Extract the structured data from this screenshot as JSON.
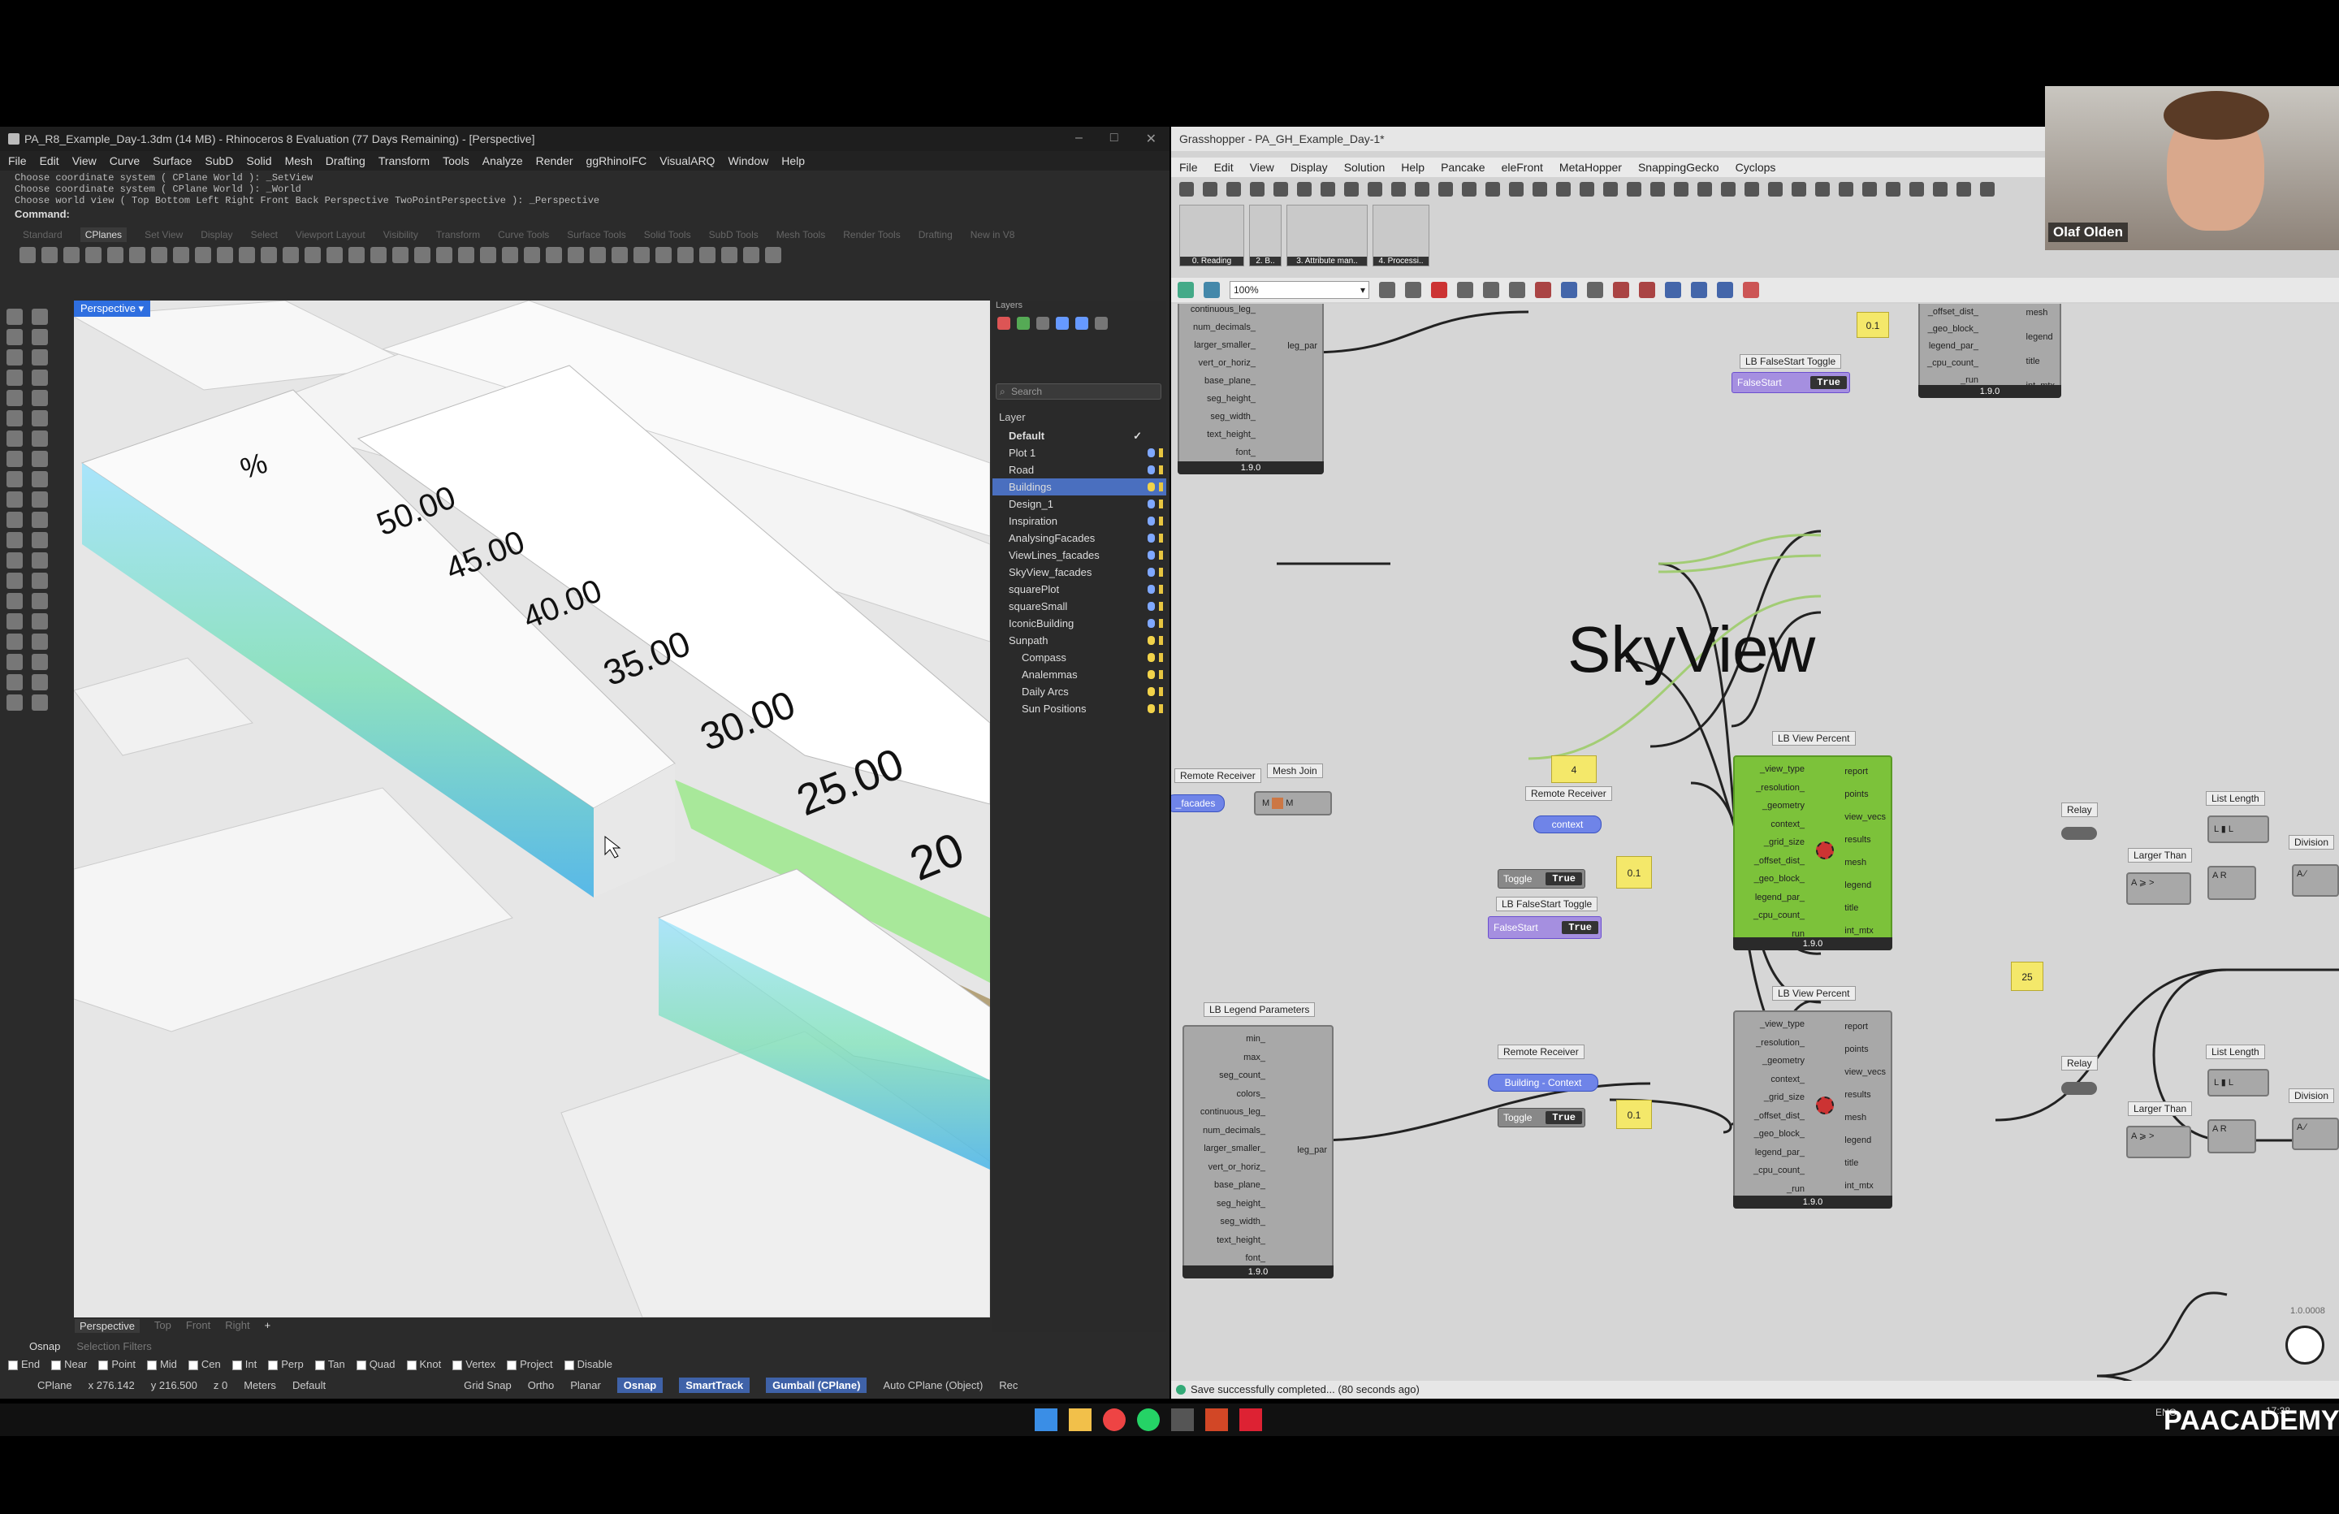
{
  "rhino": {
    "title": "PA_R8_Example_Day-1.3dm (14 MB) - Rhinoceros 8 Evaluation (77 Days Remaining) - [Perspective]",
    "menu": [
      "File",
      "Edit",
      "View",
      "Curve",
      "Surface",
      "SubD",
      "Solid",
      "Mesh",
      "Drafting",
      "Transform",
      "Tools",
      "Analyze",
      "Render",
      "ggRhinoIFC",
      "VisualARQ",
      "Window",
      "Help"
    ],
    "history": [
      "Choose coordinate system ( CPlane  World ): _SetView",
      "Choose coordinate system ( CPlane  World ): _World",
      "Choose world view ( Top  Bottom  Left  Right  Front  Back  Perspective  TwoPointPerspective ): _Perspective"
    ],
    "command_label": "Command:",
    "toolbar_tabs": [
      "Standard",
      "CPlanes",
      "Set View",
      "Display",
      "Select",
      "Viewport Layout",
      "Visibility",
      "Transform",
      "Curve Tools",
      "Surface Tools",
      "Solid Tools",
      "SubD Tools",
      "Mesh Tools",
      "Render Tools",
      "Drafting",
      "New in V8"
    ],
    "viewport_label": "Perspective",
    "viewport_tabs": [
      "Perspective",
      "Top",
      "Front",
      "Right",
      "+"
    ],
    "scale_labels": [
      "%",
      "50.00",
      "45.00",
      "40.00",
      "35.00",
      "30.00",
      "25.00",
      "20"
    ],
    "layers_title": "Layers",
    "search_placeholder": "Search",
    "layer_header": "Layer",
    "layers": [
      "Default",
      "Plot 1",
      "Road",
      "Buildings",
      "Design_1",
      "Inspiration",
      "AnalysingFacades",
      "ViewLines_facades",
      "SkyView_facades",
      "squarePlot",
      "squareSmall",
      "IconicBuilding",
      "Sunpath",
      "Compass",
      "Analemmas",
      "Daily Arcs",
      "Sun Positions"
    ],
    "osnap_tabs": [
      "Osnap",
      "Selection Filters"
    ],
    "osnaps": [
      "End",
      "Near",
      "Point",
      "Mid",
      "Cen",
      "Int",
      "Perp",
      "Tan",
      "Quad",
      "Knot",
      "Vertex",
      "Project",
      "Disable"
    ],
    "status": {
      "cplane": "CPlane",
      "x": "x 276.142",
      "y": "y 216.500",
      "z": "z 0",
      "units": "Meters",
      "layer": "Default",
      "grid": "Grid Snap",
      "ortho": "Ortho",
      "planar": "Planar",
      "osnap": "Osnap",
      "smarttrack": "SmartTrack",
      "gumball": "Gumball (CPlane)",
      "autocplane": "Auto CPlane (Object)",
      "rec": "Rec"
    }
  },
  "gh": {
    "title": "Grasshopper - PA_GH_Example_Day-1*",
    "menu": [
      "File",
      "Edit",
      "View",
      "Display",
      "Solution",
      "Help",
      "Pancake",
      "eleFront",
      "MetaHopper",
      "SnappingGecko",
      "Cyclops"
    ],
    "groups": [
      "0. Reading",
      "2. B..",
      "3. Attribute man..",
      "4. Processi.."
    ],
    "zoom": "100%",
    "heading": "SkyView",
    "status": "Save successfully completed... (80 seconds ago)",
    "version": "1.0.0008",
    "lb_view_percent": "LB View Percent",
    "lb_inputs": [
      "_view_type",
      "_resolution_",
      "_geometry",
      "context_",
      "_grid_size",
      "_offset_dist_",
      "_geo_block_",
      "legend_par_",
      "_cpu_count_",
      "_run"
    ],
    "lb_outputs": [
      "report",
      "points",
      "view_vecs",
      "results",
      "mesh",
      "legend",
      "title",
      "int_mtx"
    ],
    "legend_params": "LB Legend Parameters",
    "legend_inputs": [
      "min_",
      "max_",
      "seg_count_",
      "colors_",
      "continuous_leg_",
      "num_decimals_",
      "larger_smaller_",
      "vert_or_horiz_",
      "base_plane_",
      "seg_height_",
      "seg_width_",
      "text_height_",
      "font_"
    ],
    "top_legend_inputs": [
      "continuous_leg_",
      "num_decimals_",
      "larger_smaller_",
      "vert_or_horiz_",
      "base_plane_",
      "seg_height_",
      "seg_width_",
      "text_height_",
      "font_"
    ],
    "leg_par": "leg_par",
    "ver_190": "1.9.0",
    "remote_receiver": "Remote Receiver",
    "mesh_join": "Mesh Join",
    "recv_facades": "_facades",
    "recv_context": "context",
    "recv_building_context": "Building - Context",
    "falsestart_toggle": "LB FalseStart Toggle",
    "falsestart": "FalseStart",
    "toggle": "Toggle",
    "true_val": "True",
    "panel_4": "4",
    "panel_01": "0.1",
    "panel_25": "25",
    "relay": "Relay",
    "list_length": "List Length",
    "larger_than": "Larger Than",
    "division": "Division",
    "top_outputs": [
      "_offset_dist_",
      "_geo_block_",
      "legend_par_",
      "_cpu_count_",
      "_run"
    ],
    "top_outs": [
      "mesh",
      "legend",
      "title",
      "int_mtx"
    ]
  },
  "webcam": {
    "name": "Olaf Olden"
  },
  "taskbar": {
    "lang": "ENG",
    "time": "17:38",
    "brand": "PAACADEMY"
  }
}
